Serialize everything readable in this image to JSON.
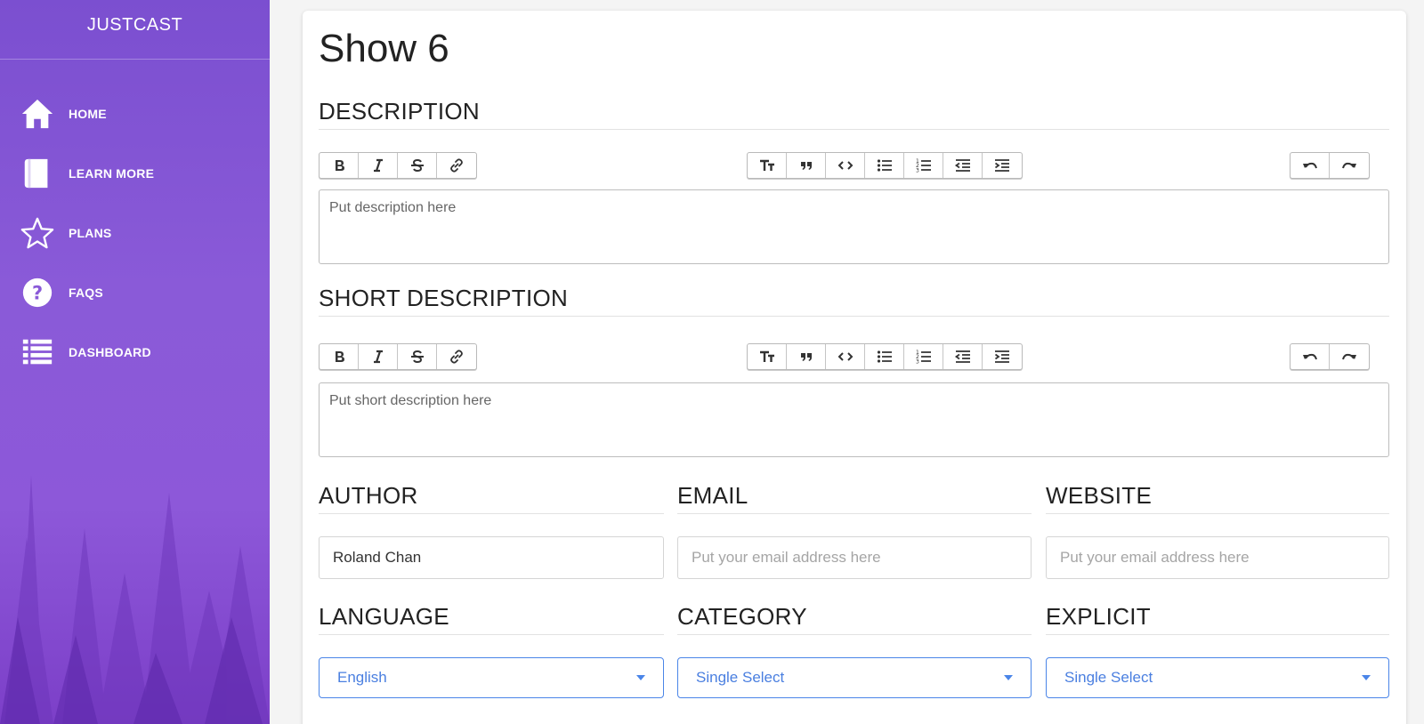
{
  "brand": "JUSTCAST",
  "nav": [
    {
      "label": "HOME",
      "icon": "home-icon"
    },
    {
      "label": "LEARN MORE",
      "icon": "book-icon"
    },
    {
      "label": "PLANS",
      "icon": "star-icon"
    },
    {
      "label": "FAQS",
      "icon": "question-icon"
    },
    {
      "label": "DASHBOARD",
      "icon": "list-icon"
    }
  ],
  "page": {
    "title": "Show 6"
  },
  "description": {
    "label": "DESCRIPTION",
    "placeholder": "Put description here"
  },
  "short_description": {
    "label": "SHORT DESCRIPTION",
    "placeholder": "Put short description here"
  },
  "toolbar": {
    "format": [
      "bold-icon",
      "italic-icon",
      "strikethrough-icon",
      "link-icon"
    ],
    "block": [
      "heading-icon",
      "quote-icon",
      "code-icon",
      "bulleted-list-icon",
      "numbered-list-icon",
      "outdent-icon",
      "indent-icon"
    ],
    "history": [
      "undo-icon",
      "redo-icon"
    ]
  },
  "author": {
    "label": "AUTHOR",
    "value": "Roland Chan"
  },
  "email": {
    "label": "EMAIL",
    "placeholder": "Put your email address here"
  },
  "website": {
    "label": "WEBSITE",
    "placeholder": "Put your email address here"
  },
  "language": {
    "label": "LANGUAGE",
    "value": "English"
  },
  "category": {
    "label": "CATEGORY",
    "value": "Single Select"
  },
  "explicit": {
    "label": "EXPLICIT",
    "value": "Single Select"
  },
  "colors": {
    "sidebar": "#8a5ad8",
    "accent": "#4a85e8"
  }
}
